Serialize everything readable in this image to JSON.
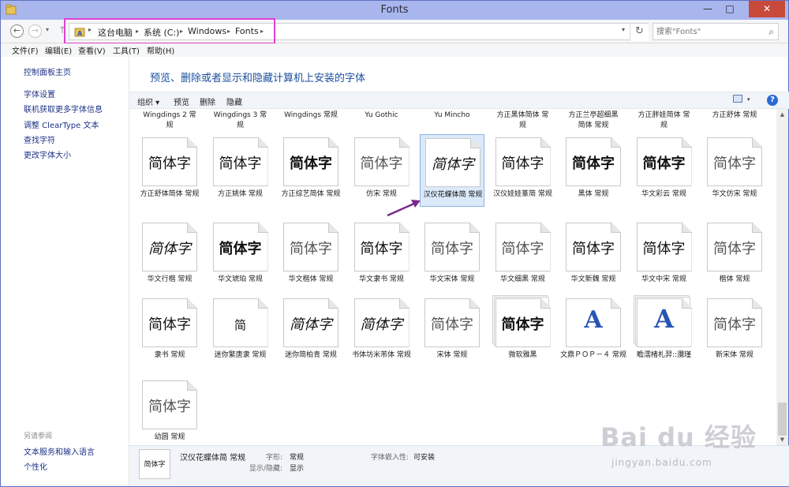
{
  "window": {
    "title": "Fonts",
    "minimize": "—",
    "maximize": "□",
    "close": "✕"
  },
  "nav": {
    "back_icon": "←",
    "forward_icon": "→",
    "recent_icon": "▾",
    "up_icon": "↑",
    "breadcrumbs": [
      "这台电脑",
      "系统 (C:)",
      "Windows",
      "Fonts"
    ],
    "crumb_sep": "▸",
    "dropdown": "▾",
    "refresh_icon": "↻",
    "search_placeholder": "搜索\"Fonts\"",
    "search_icon": "⌕"
  },
  "menu": [
    "文件(F)",
    "编辑(E)",
    "查看(V)",
    "工具(T)",
    "帮助(H)"
  ],
  "left_pane": {
    "home": "控制面板主页",
    "links": [
      "字体设置",
      "联机获取更多字体信息",
      "调整 ClearType 文本",
      "查找字符",
      "更改字体大小"
    ],
    "see_also": "另请参阅",
    "see_also_links": [
      "文本服务和输入语言",
      "个性化"
    ]
  },
  "main": {
    "title": "预览、删除或者显示和隐藏计算机上安装的字体",
    "toolbar": {
      "organize": "组织 ▾",
      "preview": "预览",
      "delete": "删除",
      "hide": "隐藏",
      "help": "?",
      "view_arrow": "▾"
    }
  },
  "top_row": [
    {
      "name": "Wingdings 2 常",
      "name2": "规"
    },
    {
      "name": "Wingdings 3 常",
      "name2": "规"
    },
    {
      "name": "Wingdings 常规",
      "name2": ""
    },
    {
      "name": "Yu Gothic",
      "name2": ""
    },
    {
      "name": "Yu Mincho",
      "name2": ""
    },
    {
      "name": "方正黑体简体 常",
      "name2": "规"
    },
    {
      "name": "方正兰亭超细黑",
      "name2": "简体 常规"
    },
    {
      "name": "方正胖娃简体 常",
      "name2": "规"
    },
    {
      "name": "方正舒体 常规",
      "name2": ""
    }
  ],
  "fonts": [
    {
      "sample": "简体字",
      "style": "",
      "label": "方正舒体简体 常规"
    },
    {
      "sample": "简体字",
      "style": "",
      "label": "方正姚体 常规"
    },
    {
      "sample": "简体字",
      "style": "bold",
      "label": "方正综艺简体 常规"
    },
    {
      "sample": "简体字",
      "style": "thin",
      "label": "仿宋 常规"
    },
    {
      "sample": "简体字",
      "style": "italic",
      "label": "汉仪花蝶体简 常规",
      "selected": true
    },
    {
      "sample": "简体字",
      "style": "",
      "label": "汉仪娃娃篆简 常规"
    },
    {
      "sample": "简体字",
      "style": "bold",
      "label": "黑体 常规"
    },
    {
      "sample": "简体字",
      "style": "bold",
      "label": "华文彩云 常规"
    },
    {
      "sample": "简体字",
      "style": "thin",
      "label": "华文仿宋 常规"
    },
    {
      "sample": "简体字",
      "style": "italic",
      "label": "华文行楷 常规"
    },
    {
      "sample": "简体字",
      "style": "bold",
      "label": "华文琥珀 常规"
    },
    {
      "sample": "简体字",
      "style": "thin",
      "label": "华文楷体 常规"
    },
    {
      "sample": "简体字",
      "style": "",
      "label": "华文隶书 常规"
    },
    {
      "sample": "简体字",
      "style": "thin",
      "label": "华文宋体 常规"
    },
    {
      "sample": "简体字",
      "style": "thin",
      "label": "华文细黑 常规"
    },
    {
      "sample": "简体字",
      "style": "",
      "label": "华文新魏 常规"
    },
    {
      "sample": "简体字",
      "style": "",
      "label": "华文中宋 常规"
    },
    {
      "sample": "简体字",
      "style": "thin",
      "label": "楷体 常规"
    },
    {
      "sample": "简体字",
      "style": "",
      "label": "隶书 常规"
    },
    {
      "sample": "简",
      "style": "small",
      "label": "迷你繁唐隶 常规"
    },
    {
      "sample": "简体字",
      "style": "italic",
      "label": "迷你简柏青 常规"
    },
    {
      "sample": "简体字",
      "style": "italic",
      "label": "书体坊米芾体 常规"
    },
    {
      "sample": "简体字",
      "style": "thin",
      "label": "宋体 常规"
    },
    {
      "sample": "简体字",
      "style": "stack",
      "label": "微软雅黑"
    },
    {
      "sample": "A",
      "style": "a",
      "label": "文鼎ＰＯＰ－４ 常规"
    },
    {
      "sample": "A",
      "style": "a-stack",
      "label": "瞻濡楮札羿::瀰瑾"
    },
    {
      "sample": "简体字",
      "style": "thin",
      "label": "新宋体 常规"
    },
    {
      "sample": "简体字",
      "style": "thin",
      "label": "幼圆 常规"
    }
  ],
  "details": {
    "thumb_sample": "简体字",
    "name": "汉仪花蝶体简 常规",
    "style_key": "字形:",
    "style_val": "常规",
    "show_key": "显示/隐藏:",
    "show_val": "显示",
    "embed_key": "字体嵌入性:",
    "embed_val": "可安装"
  },
  "watermark": {
    "main": "Bai du 经验",
    "sub": "jingyan.baidu.com"
  },
  "colors": {
    "accent": "#1b50a0",
    "link": "#1e3287",
    "selection": "#dbe9f9",
    "highlight": "#e040d0",
    "arrow": "#7a2a8a"
  }
}
